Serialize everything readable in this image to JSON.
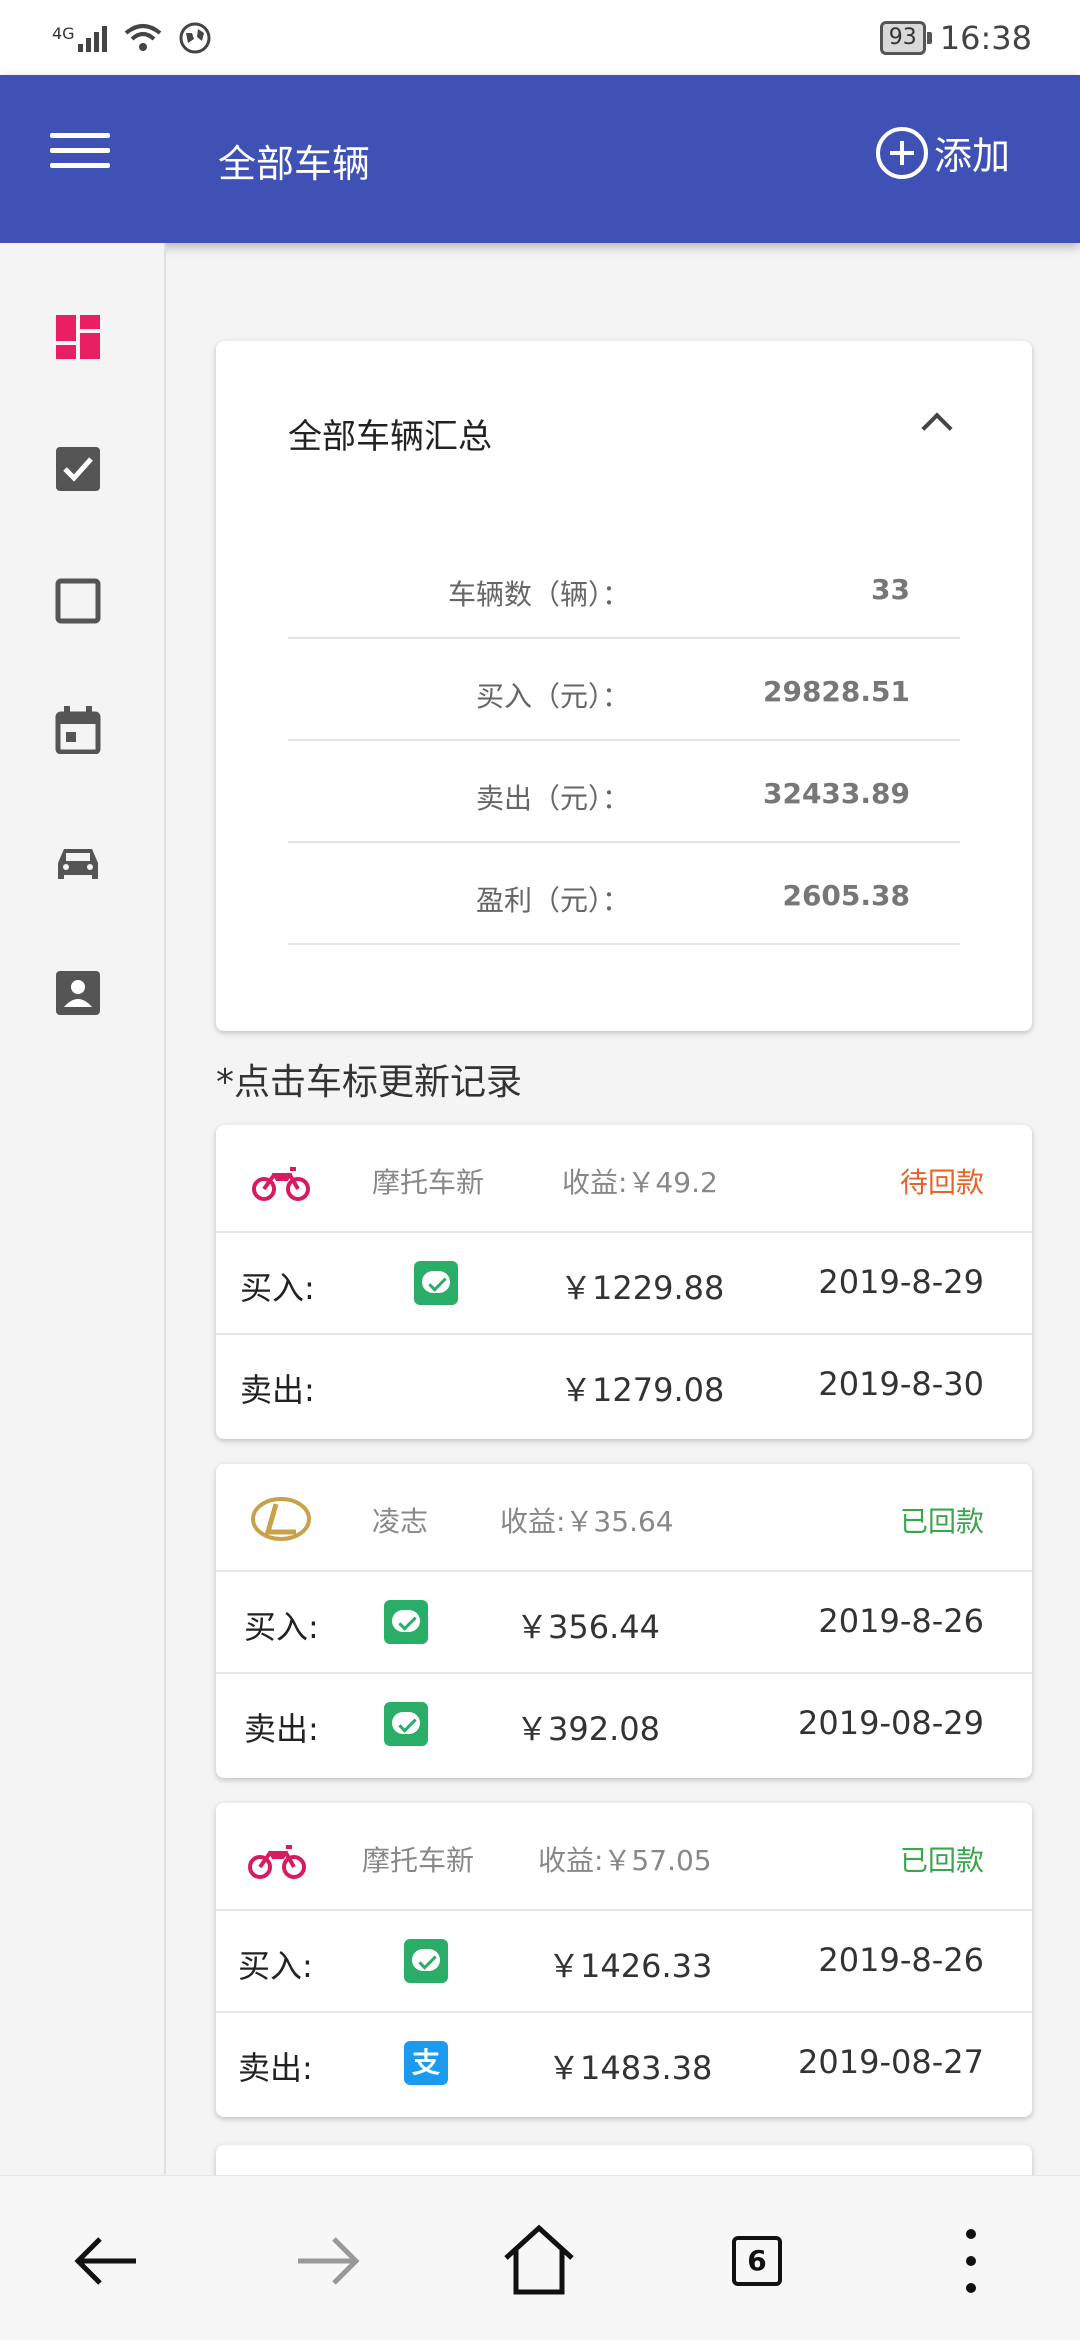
{
  "status_bar": {
    "network": "4G",
    "battery": "93",
    "time": "16:38"
  },
  "appbar": {
    "title": "全部车辆",
    "add_label": "添加"
  },
  "summary": {
    "title": "全部车辆汇总",
    "rows": [
      {
        "label": "车辆数（辆）：",
        "value": "33"
      },
      {
        "label": "买入（元）：",
        "value": "29828.51"
      },
      {
        "label": "卖出（元）：",
        "value": "32433.89"
      },
      {
        "label": "盈利（元）：",
        "value": "2605.38"
      }
    ]
  },
  "hint": "*点击车标更新记录",
  "records": [
    {
      "logo": "motorcycle-icon",
      "name": "摩托车新",
      "profit": "收益:￥49.2",
      "status": "待回款",
      "status_color": "#e8622a",
      "buy_label": "买入:",
      "buy_pay": "wechat-pay-icon",
      "buy_amount": "￥1229.88",
      "buy_date": "2019-8-29",
      "sell_label": "卖出:",
      "sell_pay": "",
      "sell_amount": "￥1279.08",
      "sell_date": "2019-8-30"
    },
    {
      "logo": "lexus-logo-icon",
      "name": "凌志",
      "profit": "收益:￥35.64",
      "status": "已回款",
      "status_color": "#3aa64a",
      "buy_label": "买入:",
      "buy_pay": "wechat-pay-icon",
      "buy_amount": "￥356.44",
      "buy_date": "2019-8-26",
      "sell_label": "卖出:",
      "sell_pay": "wechat-pay-icon",
      "sell_amount": "￥392.08",
      "sell_date": "2019-08-29"
    },
    {
      "logo": "motorcycle-icon",
      "name": "摩托车新",
      "profit": "收益:￥57.05",
      "status": "已回款",
      "status_color": "#3aa64a",
      "buy_label": "买入:",
      "buy_pay": "wechat-pay-icon",
      "buy_amount": "￥1426.33",
      "buy_date": "2019-8-26",
      "sell_label": "卖出:",
      "sell_pay": "alipay-icon",
      "sell_amount": "￥1483.38",
      "sell_date": "2019-08-27"
    }
  ],
  "alipay_glyph": "支",
  "bottom_nav": {
    "tabs_count": "6"
  },
  "colors": {
    "appbar": "#3f51b5",
    "active_sidebar": "#e91e63",
    "motorcycle": "#d81b60",
    "lexus": "#c8a24a"
  }
}
